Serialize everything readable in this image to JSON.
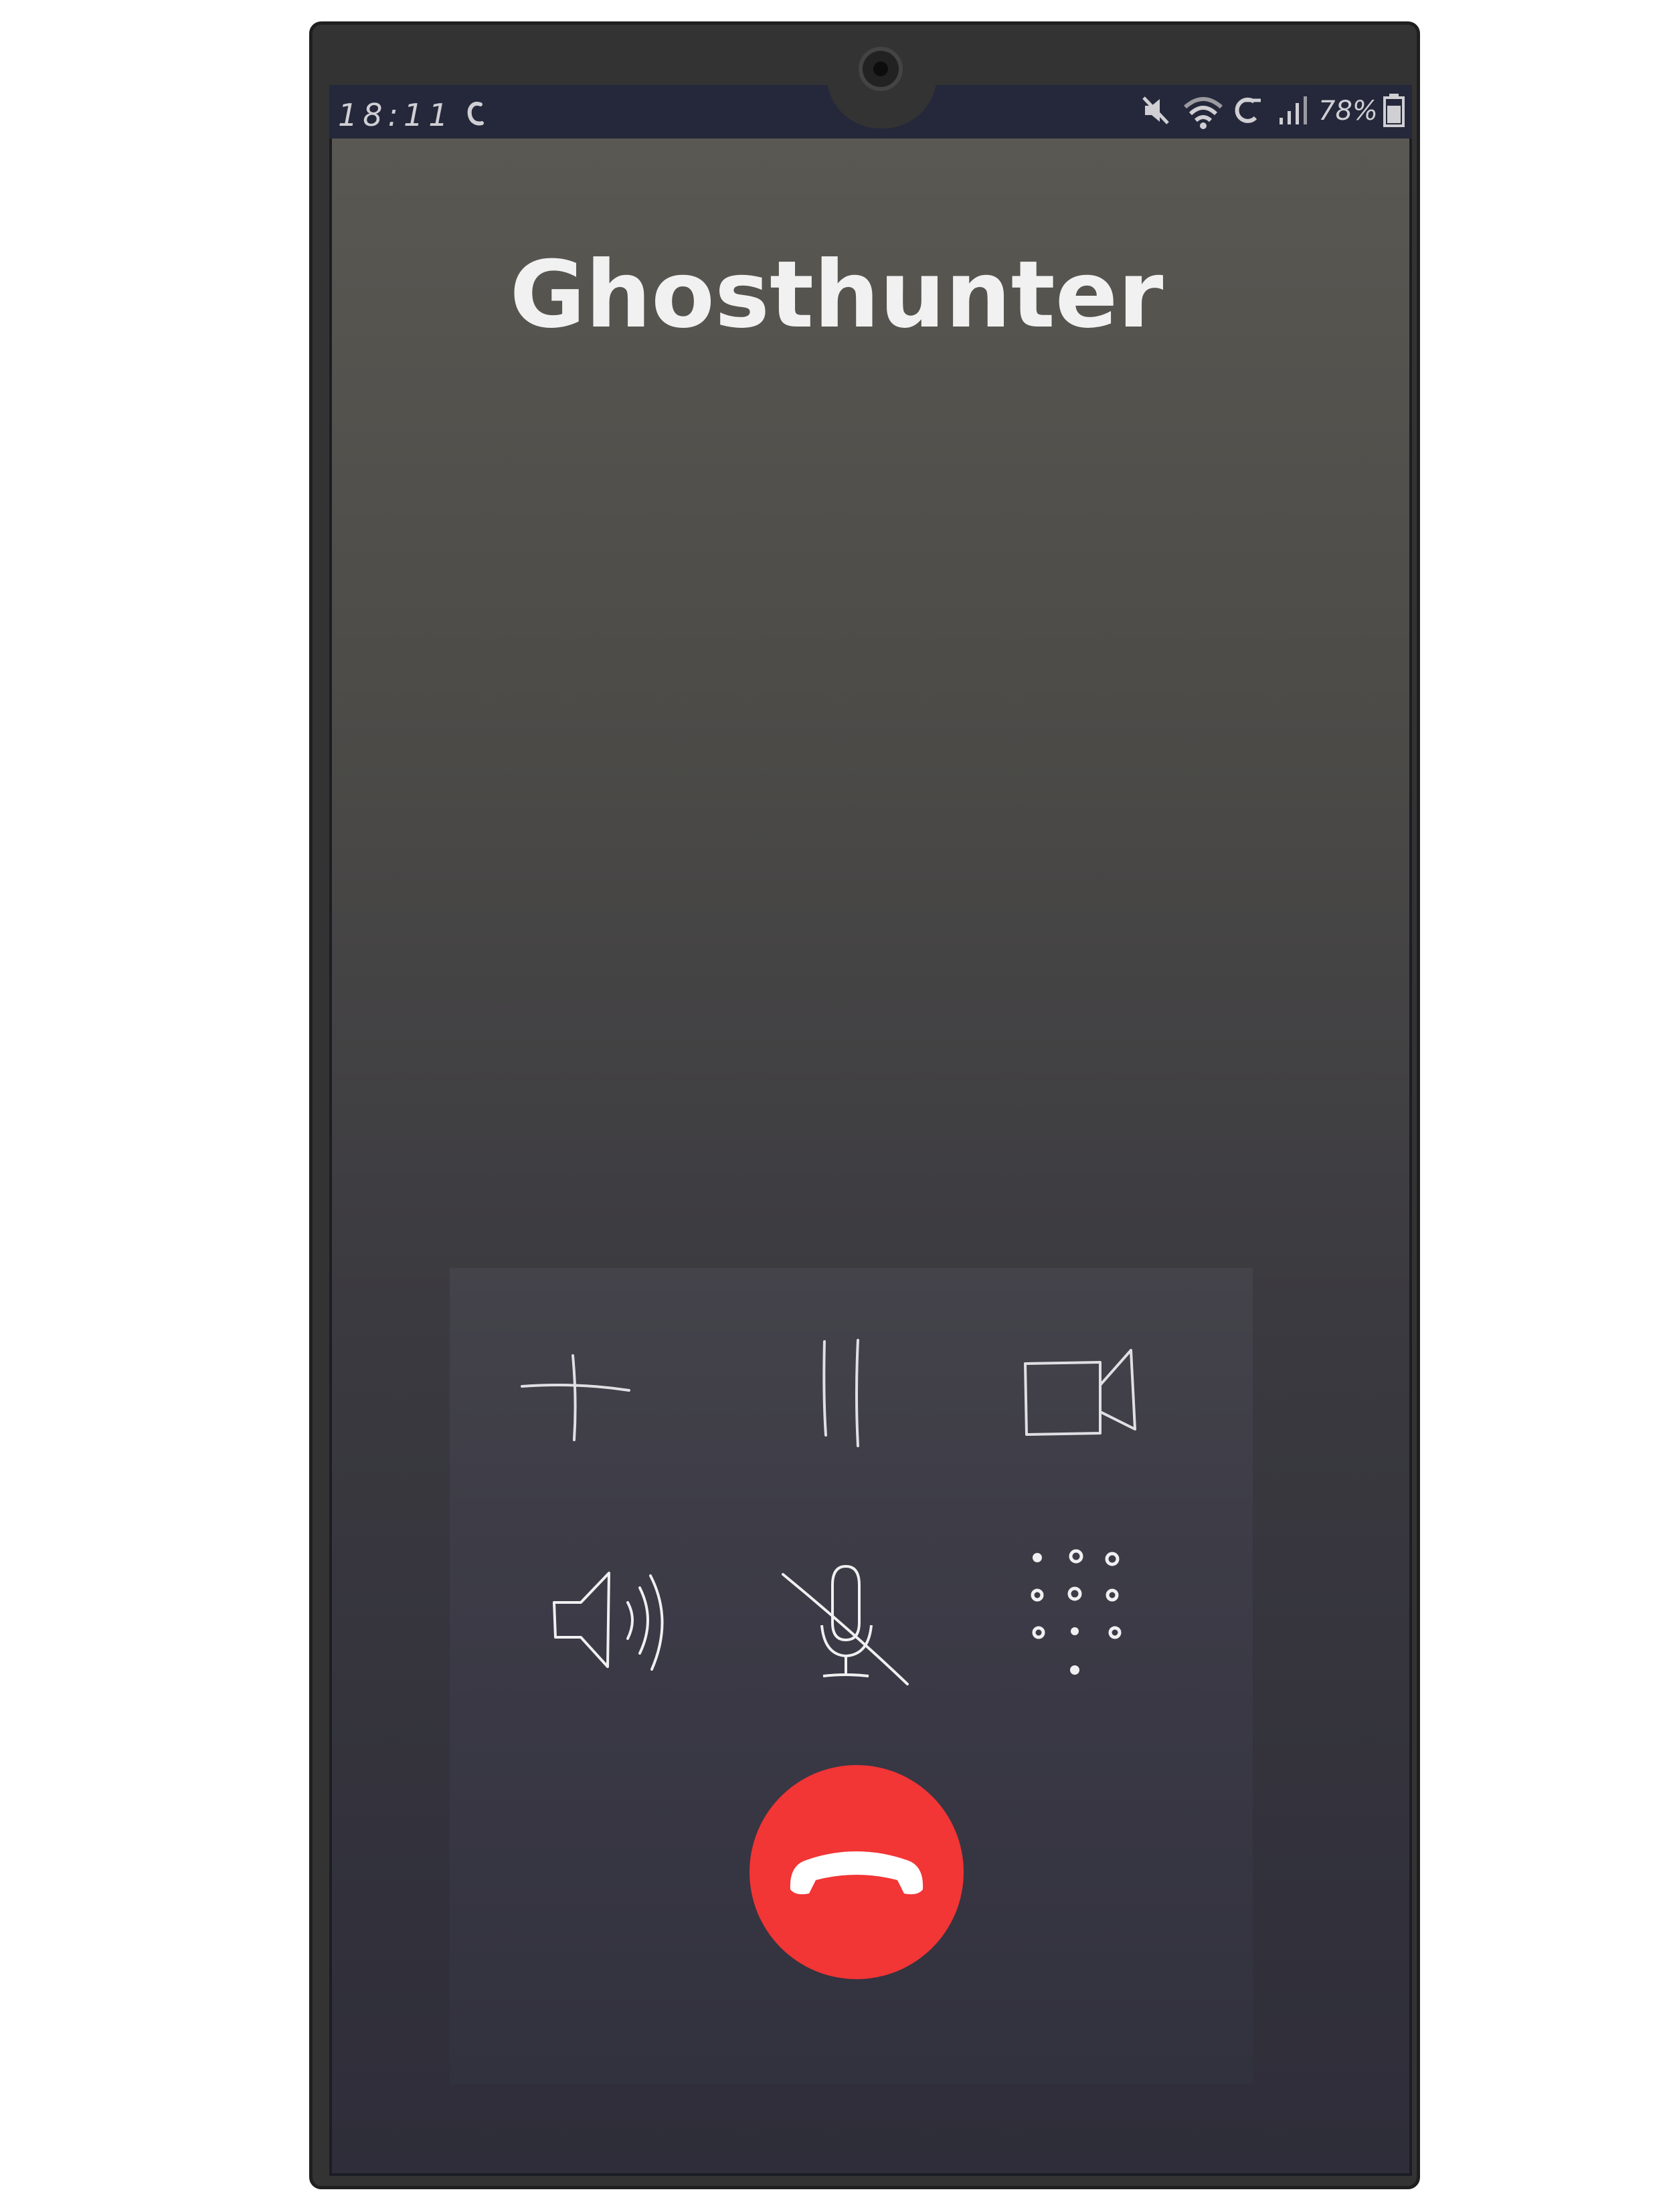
{
  "status_bar": {
    "time": "18:11",
    "battery_percent": "78%",
    "icons": [
      "call-active-icon",
      "mute-icon",
      "wifi-icon",
      "data-sync-icon",
      "signal-icon",
      "battery-icon"
    ]
  },
  "call": {
    "caller_name": "Ghosthunter"
  },
  "controls": {
    "icons": [
      "add-call-icon",
      "hold-icon",
      "video-call-icon",
      "speaker-icon",
      "mute-mic-icon",
      "keypad-icon",
      "end-call-icon"
    ]
  },
  "colors": {
    "end_call": "#f23535",
    "status_bar": "#25283a",
    "icon": "#e8e8e8"
  }
}
